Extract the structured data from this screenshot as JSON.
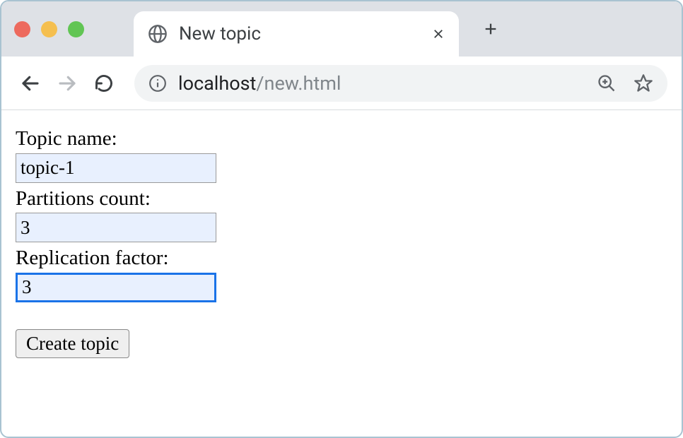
{
  "browser": {
    "tab_title": "New topic",
    "url_host": "localhost",
    "url_path": "/new.html"
  },
  "form": {
    "topic_name_label": "Topic name:",
    "topic_name_value": "topic-1",
    "partitions_label": "Partitions count:",
    "partitions_value": "3",
    "replication_label": "Replication factor:",
    "replication_value": "3",
    "submit_label": "Create topic"
  }
}
